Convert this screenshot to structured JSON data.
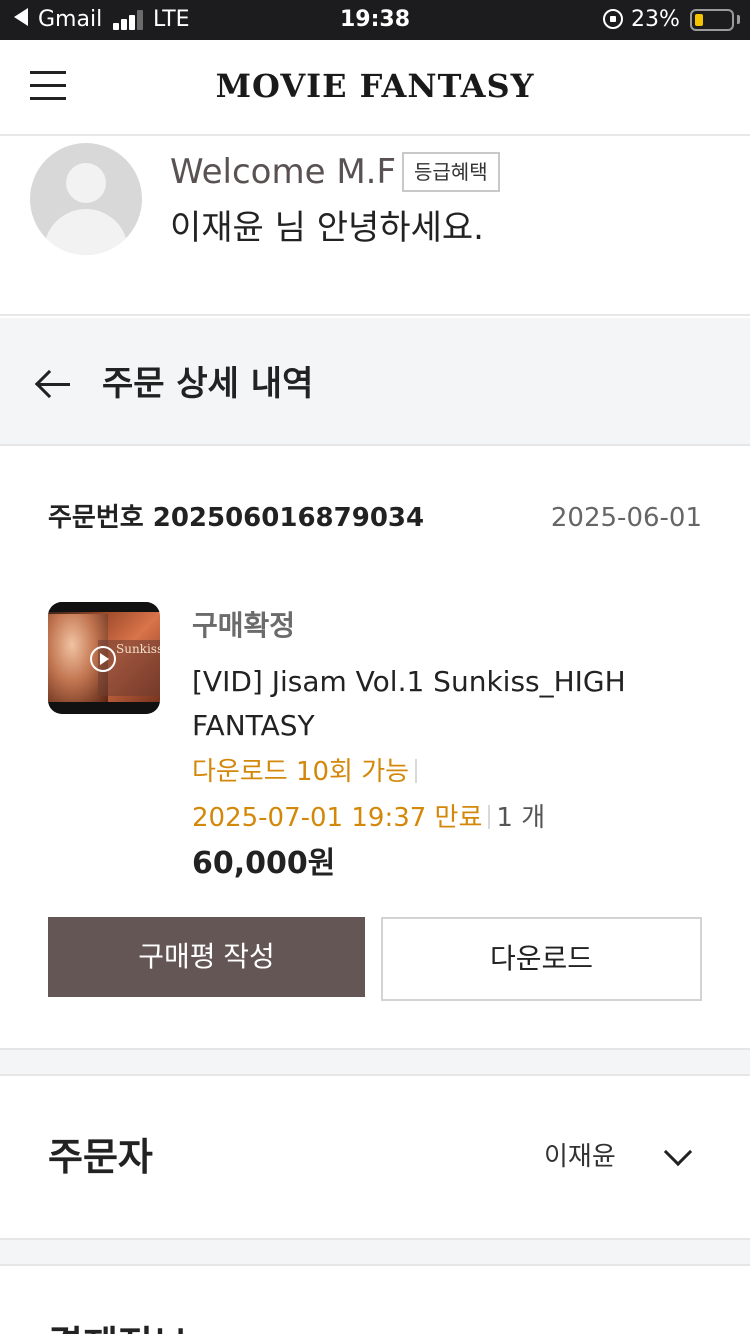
{
  "status_bar": {
    "app": "Gmail",
    "network": "LTE",
    "time": "19:38",
    "battery_percent": "23%",
    "battery_level": 0.23,
    "battery_color": "#f5c400"
  },
  "header": {
    "logo": "MOVIE FANTASY",
    "menu_icon": "hamburger-menu-icon"
  },
  "profile": {
    "welcome": "Welcome M.F",
    "grade_badge": "등급혜택",
    "greeting": "이재윤 님 안녕하세요."
  },
  "section": {
    "title": "주문 상세 내역",
    "back_icon": "back-arrow-icon"
  },
  "order": {
    "number_label": "주문번호 202506016879034",
    "date": "2025-06-01",
    "item": {
      "thumbnail_brand": "Sunkiss",
      "status": "구매확정",
      "name": "[VID] Jisam Vol.1 Sunkiss_HIGH FANTASY",
      "download_info": "다운로드 10회 가능",
      "expiry": "2025-07-01 19:37 만료",
      "quantity": "1 개",
      "price": "60,000원"
    },
    "buttons": {
      "review": "구매평 작성",
      "download": "다운로드"
    }
  },
  "orderer": {
    "label": "주문자",
    "name": "이재윤",
    "expand_icon": "chevron-down-icon"
  },
  "payment": {
    "label": "결제정보"
  },
  "colors": {
    "accent_orange": "#d4880a",
    "button_dark": "#645654"
  }
}
